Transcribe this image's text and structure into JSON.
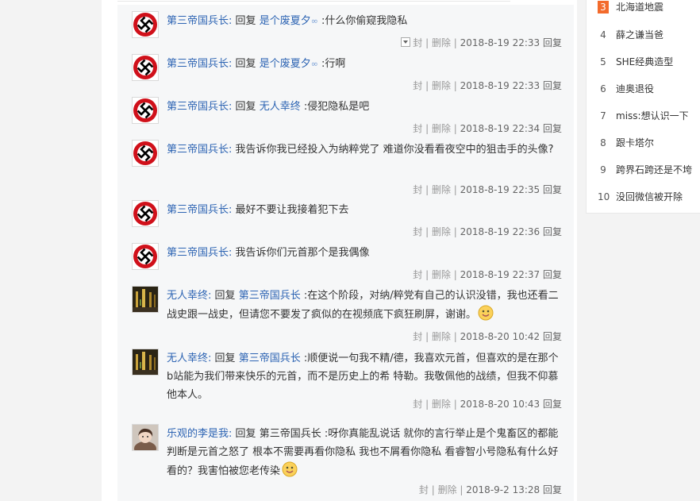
{
  "sidebar": {
    "items": [
      {
        "rank": "3",
        "title": "北海道地震"
      },
      {
        "rank": "4",
        "title": "薛之谦当爸"
      },
      {
        "rank": "5",
        "title": "SHE经典造型"
      },
      {
        "rank": "6",
        "title": "迪奥退役"
      },
      {
        "rank": "7",
        "title": "miss:想认识一下"
      },
      {
        "rank": "8",
        "title": "跟卡塔尔"
      },
      {
        "rank": "9",
        "title": "跨界石跨还是不垮"
      },
      {
        "rank": "10",
        "title": "没回微信被开除"
      }
    ]
  },
  "meta_labels": {
    "block": "封",
    "delete": "删除",
    "reply": "回复",
    "sep": "|"
  },
  "replies": [
    {
      "user": "第三帝国兵长:",
      "prefix": "回复",
      "target": "是个废夏夕",
      "text": ":什么你偷窥我隐私",
      "time": "2018-8-19 22:33",
      "avatar": "swastika",
      "target_link": true,
      "dropdown": true
    },
    {
      "user": "第三帝国兵长:",
      "prefix": "回复",
      "target": "是个废夏夕",
      "text": ":行啊",
      "time": "2018-8-19 22:33",
      "avatar": "swastika",
      "target_link": true
    },
    {
      "user": "第三帝国兵长:",
      "prefix": "回复",
      "target": "无人幸终",
      "text": ":侵犯隐私是吧",
      "time": "2018-8-19 22:34",
      "avatar": "swastika"
    },
    {
      "user": "第三帝国兵长:",
      "prefix": "",
      "target": "",
      "text": "我告诉你我已经投入为纳粹党了 难道你没看看夜空中的狙击手的头像?",
      "time": "2018-8-19 22:35",
      "avatar": "swastika"
    },
    {
      "user": "第三帝国兵长:",
      "prefix": "",
      "target": "",
      "text": "最好不要让我接着犯下去",
      "time": "2018-8-19 22:36",
      "avatar": "swastika"
    },
    {
      "user": "第三帝国兵长:",
      "prefix": "",
      "target": "",
      "text": "我告诉你们元首那个是我偶像",
      "time": "2018-8-19 22:37",
      "avatar": "swastika"
    },
    {
      "user": "无人幸终:",
      "prefix": "回复",
      "target": "第三帝国兵长",
      "text": ":在这个阶段，对纳/粹党有自己的认识没错，我也还看二战史跟一战史，但请您不要发了疯似的在视频底下疯狂刷屏，谢谢。",
      "time": "2018-8-20 10:42",
      "avatar": "dark",
      "emoji": true
    },
    {
      "user": "无人幸终:",
      "prefix": "回复",
      "target": "第三帝国兵长",
      "text": ":顺便说一句我不精/德，我喜欢元首，但喜欢的是在那个b站能为我们带来快乐的元首，而不是历史上的希 特勒。我敬佩他的战绩，但我不仰慕他本人。",
      "time": "2018-8-20 10:43",
      "avatar": "dark"
    },
    {
      "user": "乐观的李是我:",
      "prefix": "回复",
      "target": "第三帝国兵长",
      "text": ":呀你真能乱说话 就你的言行举止是个鬼畜区的都能判断是元首之怒了 根本不需要再看你隐私 我也不屑看你隐私 看睿智小号隐私有什么好看的？我害怕被您老传染",
      "time": "2018-9-2 13:28",
      "avatar": "girl",
      "emoji": true,
      "plain_target": true
    }
  ]
}
